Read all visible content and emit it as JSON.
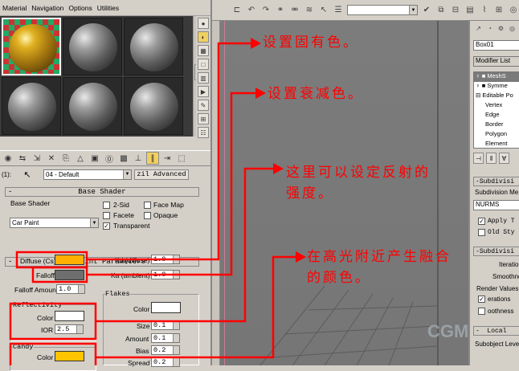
{
  "menu": {
    "items": [
      "Material",
      "Navigation",
      "Options",
      "Utilities"
    ]
  },
  "material_editor": {
    "name_prefix": "(1):",
    "material_name": "04 - Default",
    "type_button": "zil Advanced"
  },
  "base_shader": {
    "header": "Base Shader",
    "label": "Base Shader",
    "shader_value": "Car Paint",
    "options": [
      {
        "label": "2-Sid",
        "checked": false
      },
      {
        "label": "Face Map",
        "checked": false
      },
      {
        "label": "Facete",
        "checked": false
      },
      {
        "label": "Opaque",
        "checked": false
      },
      {
        "label": "Transparent",
        "checked": true
      }
    ]
  },
  "car_paint": {
    "header": "Car Paint Parameters",
    "diffuse_label": "Diffuse (Cs)",
    "falloff_label": "Falloff",
    "falloff_amount_label": "Falloff Amount",
    "falloff_amount_value": "1.0",
    "ka_diffuse_label": "Kd (diffuse)",
    "ka_diffuse_value": "1.0",
    "ka_ambient_label": "Ka (ambient)",
    "ka_ambient_value": "1.0",
    "reflectivity_label": "Reflectivity",
    "color_label": "Color",
    "ior_label": "IOR",
    "ior_value": "2.5",
    "flakes_label": "Flakes",
    "flakes_color_label": "Color",
    "flakes_size_label": "Size",
    "flakes_size_value": "0.1",
    "amount_label": "Amount",
    "amount_value": "0.1",
    "bias_label": "Bias",
    "bias_value": "0.2",
    "spread_label": "Spread",
    "spread_value": "0.2",
    "candy_label": "Candy",
    "candy_color_label": "Color"
  },
  "colors": {
    "diffuse": "#ffb000",
    "falloff": "#6e6e6e",
    "reflect_color": "#ffffff",
    "flakes_color": "#ffffff",
    "candy_color": "#ffc400",
    "annotation": "#ff0000"
  },
  "command_panel": {
    "object_name": "Box01",
    "modifier_list": "Modifier List",
    "stack": [
      "MeshS",
      "Symme",
      "Editable Po",
      "Vertex",
      "Edge",
      "Border",
      "Polygon",
      "Element"
    ],
    "subdivision_header": "Subdivisi",
    "subdivision_method_label": "Subdivision Me",
    "method_value": "NURMS",
    "apply_label": "Apply T",
    "old_style_label": "Old Sty",
    "subdivision_header2": "Subdivisi",
    "iteration_label": "Iteratio",
    "smoothness_label": "Smoothne",
    "render_values_label": "Render Values",
    "iterations_label": "erations",
    "smoothness2_label": "oothness",
    "local_header": "Local",
    "subobject_label": "Subobject Leve"
  },
  "annotations": [
    "设置固有色。",
    "设置衰减色。",
    "这里可以设定反射的",
    "强度。",
    "在高光附近产生融合",
    "的颜色。"
  ],
  "watermark": "CGM"
}
